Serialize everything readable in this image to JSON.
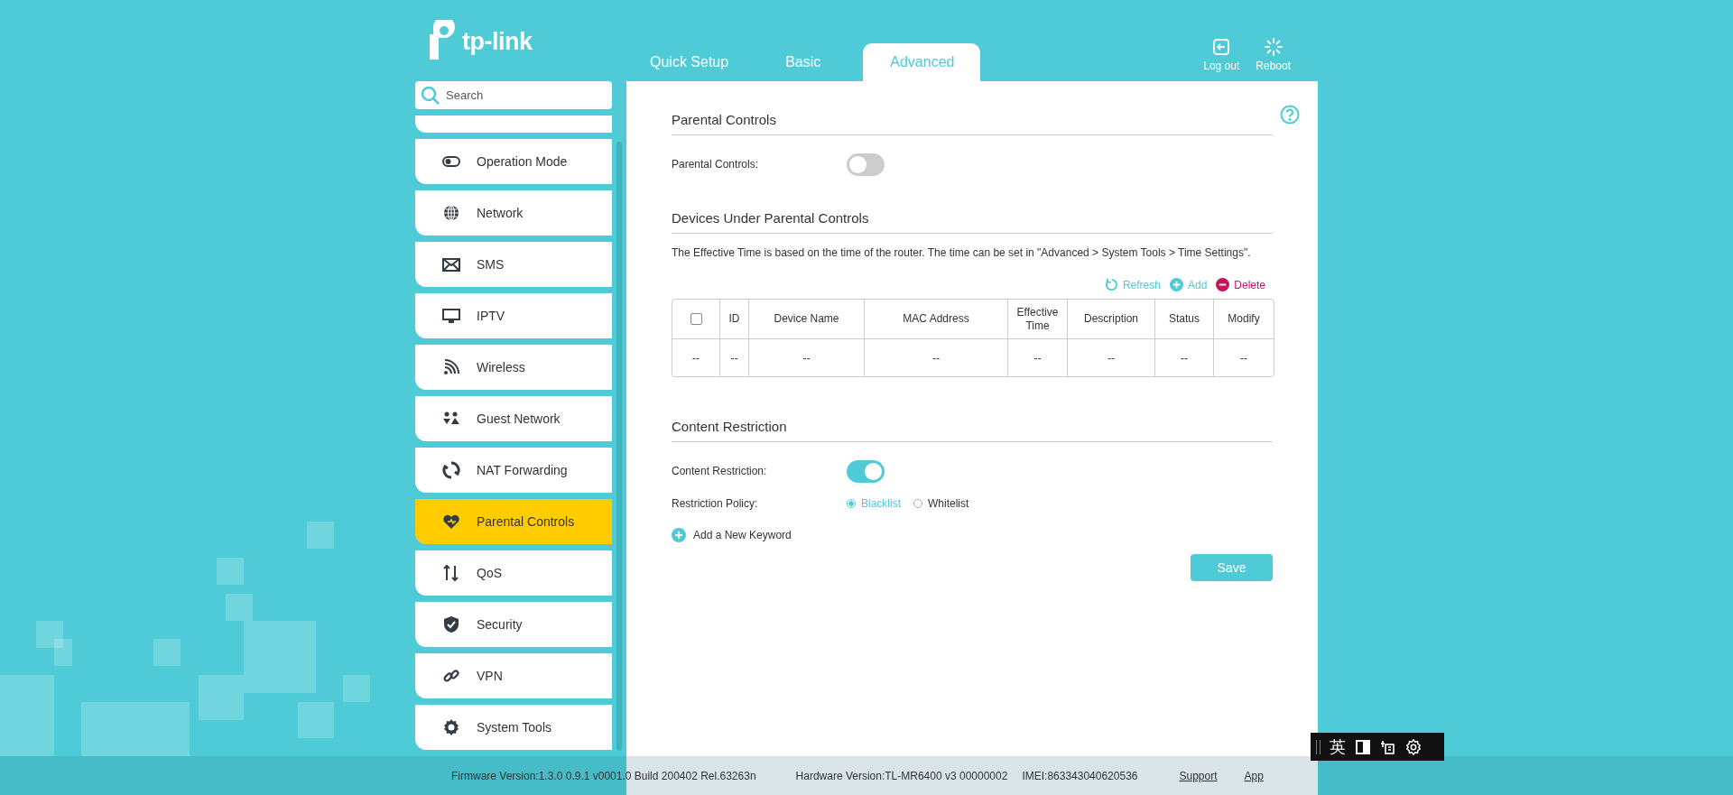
{
  "brand": "tp-link",
  "tabs": [
    {
      "label": "Quick Setup",
      "selected": false
    },
    {
      "label": "Basic",
      "selected": false
    },
    {
      "label": "Advanced",
      "selected": true
    }
  ],
  "header_actions": [
    {
      "label": "Log out"
    },
    {
      "label": "Reboot"
    }
  ],
  "search": {
    "placeholder": "Search"
  },
  "sidebar": {
    "items": [
      {
        "label": "Operation Mode",
        "selected": false
      },
      {
        "label": "Network",
        "selected": false
      },
      {
        "label": "SMS",
        "selected": false
      },
      {
        "label": "IPTV",
        "selected": false
      },
      {
        "label": "Wireless",
        "selected": false
      },
      {
        "label": "Guest Network",
        "selected": false
      },
      {
        "label": "NAT Forwarding",
        "selected": false
      },
      {
        "label": "Parental Controls",
        "selected": true
      },
      {
        "label": "QoS",
        "selected": false
      },
      {
        "label": "Security",
        "selected": false
      },
      {
        "label": "VPN",
        "selected": false
      },
      {
        "label": "System Tools",
        "selected": false
      }
    ]
  },
  "parental_section": {
    "title": "Parental Controls",
    "label": "Parental Controls:",
    "on": false
  },
  "devices_section": {
    "title": "Devices Under Parental Controls",
    "note": "The Effective Time is based on the time of the router. The time can be set in \"Advanced > System Tools > Time Settings\".",
    "actions": [
      {
        "kind": "refresh",
        "label": "Refresh"
      },
      {
        "kind": "add",
        "label": "Add"
      },
      {
        "kind": "delete",
        "label": "Delete"
      }
    ],
    "table": {
      "select_all_checked": false,
      "columns": [
        "",
        "ID",
        "Device Name",
        "MAC Address",
        "Effective Time",
        "Description",
        "Status",
        "Modify"
      ],
      "rows": [
        [
          "--",
          "--",
          "--",
          "--",
          "--",
          "--",
          "--",
          "--"
        ]
      ]
    }
  },
  "content_section": {
    "title": "Content Restriction",
    "label": "Content Restriction:",
    "on": true,
    "policy_label": "Restriction Policy:",
    "policies": [
      {
        "label": "Blacklist",
        "selected": true
      },
      {
        "label": "Whitelist",
        "selected": false
      }
    ],
    "add_keyword": "Add a New Keyword",
    "save": "Save"
  },
  "footer": {
    "firmware": "Firmware Version:1.3.0 0.9.1 v0001.0 Build 200402 Rel.63263n",
    "hardware": "Hardware Version:TL-MR6400 v3 00000002",
    "imei": "IMEI:863343040620536",
    "links": [
      "Support",
      "App"
    ]
  },
  "ime_toolbar": {
    "language": "英"
  }
}
